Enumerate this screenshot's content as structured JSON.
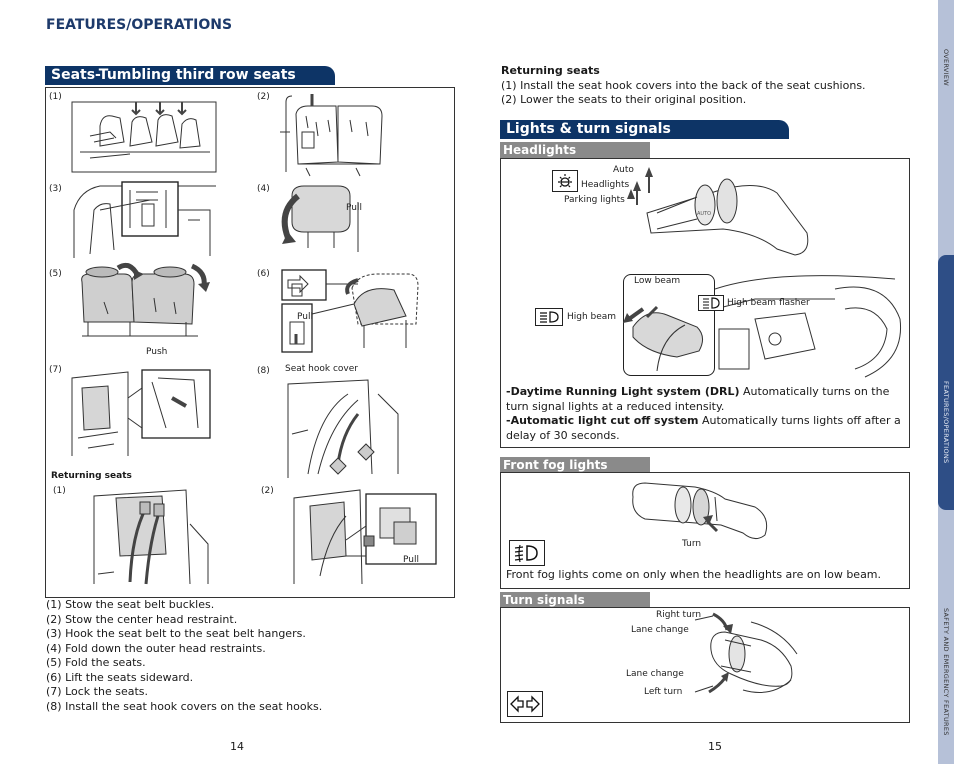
{
  "page_header": "FEATURES/OPERATIONS",
  "left": {
    "section_title": "Seats-Tumbling third row seats",
    "figures": [
      {
        "num": "(1)"
      },
      {
        "num": "(2)"
      },
      {
        "num": "(3)"
      },
      {
        "num": "(4)",
        "labels": [
          "Pull"
        ]
      },
      {
        "num": "(5)",
        "labels": [
          "Push"
        ]
      },
      {
        "num": "(6)",
        "labels": [
          "Pull"
        ]
      },
      {
        "num": "(7)"
      },
      {
        "num": "(8)",
        "labels": [
          "Seat hook cover"
        ]
      }
    ],
    "returning_title": "Returning seats",
    "returning_figures": [
      {
        "num": "(1)"
      },
      {
        "num": "(2)",
        "labels": [
          "Pull"
        ]
      }
    ],
    "steps": [
      "(1) Stow the seat belt buckles.",
      "(2) Stow the center head restraint.",
      "(3) Hook the seat belt to the seat belt hangers.",
      "(4) Fold down the outer head restraints.",
      "(5) Fold the seats.",
      "(6) Lift the seats sideward.",
      "(7) Lock the seats.",
      "(8) Install the seat hook covers on the seat hooks."
    ],
    "page_number": "14"
  },
  "right": {
    "returning": {
      "title": "Returning seats",
      "steps": [
        "(1) Install the seat hook covers into the back of the seat cushions.",
        "(2) Lower the seats to their original position."
      ]
    },
    "section_title": "Lights & turn signals",
    "headlights": {
      "title": "Headlights",
      "labels": {
        "auto": "Auto",
        "headlights": "Headlights",
        "parking": "Parking lights",
        "low_beam": "Low beam",
        "high_beam": "High beam",
        "high_beam_flasher": "High beam flasher"
      },
      "notes": [
        {
          "bold": "-Daytime Running Light system (DRL)",
          "text": " Automatically turns on the turn signal lights at a reduced intensity."
        },
        {
          "bold": "-Automatic light cut off system",
          "text": " Automatically turns lights off after a delay of 30 seconds."
        }
      ]
    },
    "fog": {
      "title": "Front fog lights",
      "labels": {
        "turn": "Turn"
      },
      "note": "Front fog lights come on only when the headlights are on low beam."
    },
    "turn_signals": {
      "title": "Turn signals",
      "labels": {
        "right_turn": "Right turn",
        "lane_change_up": "Lane change",
        "lane_change_down": "Lane change",
        "left_turn": "Left turn"
      }
    },
    "page_number": "15"
  },
  "side_tabs": [
    {
      "label": "Overview",
      "active": false
    },
    {
      "label": "Features/Operations",
      "active": true
    },
    {
      "label": "Safety and Emergency Features",
      "active": false
    }
  ],
  "colors": {
    "header_blue": "#0d3466",
    "sub_header_gray": "#8a8a8a",
    "side_bar": "#b6c1d8",
    "side_tab_active": "#2e4e86"
  }
}
